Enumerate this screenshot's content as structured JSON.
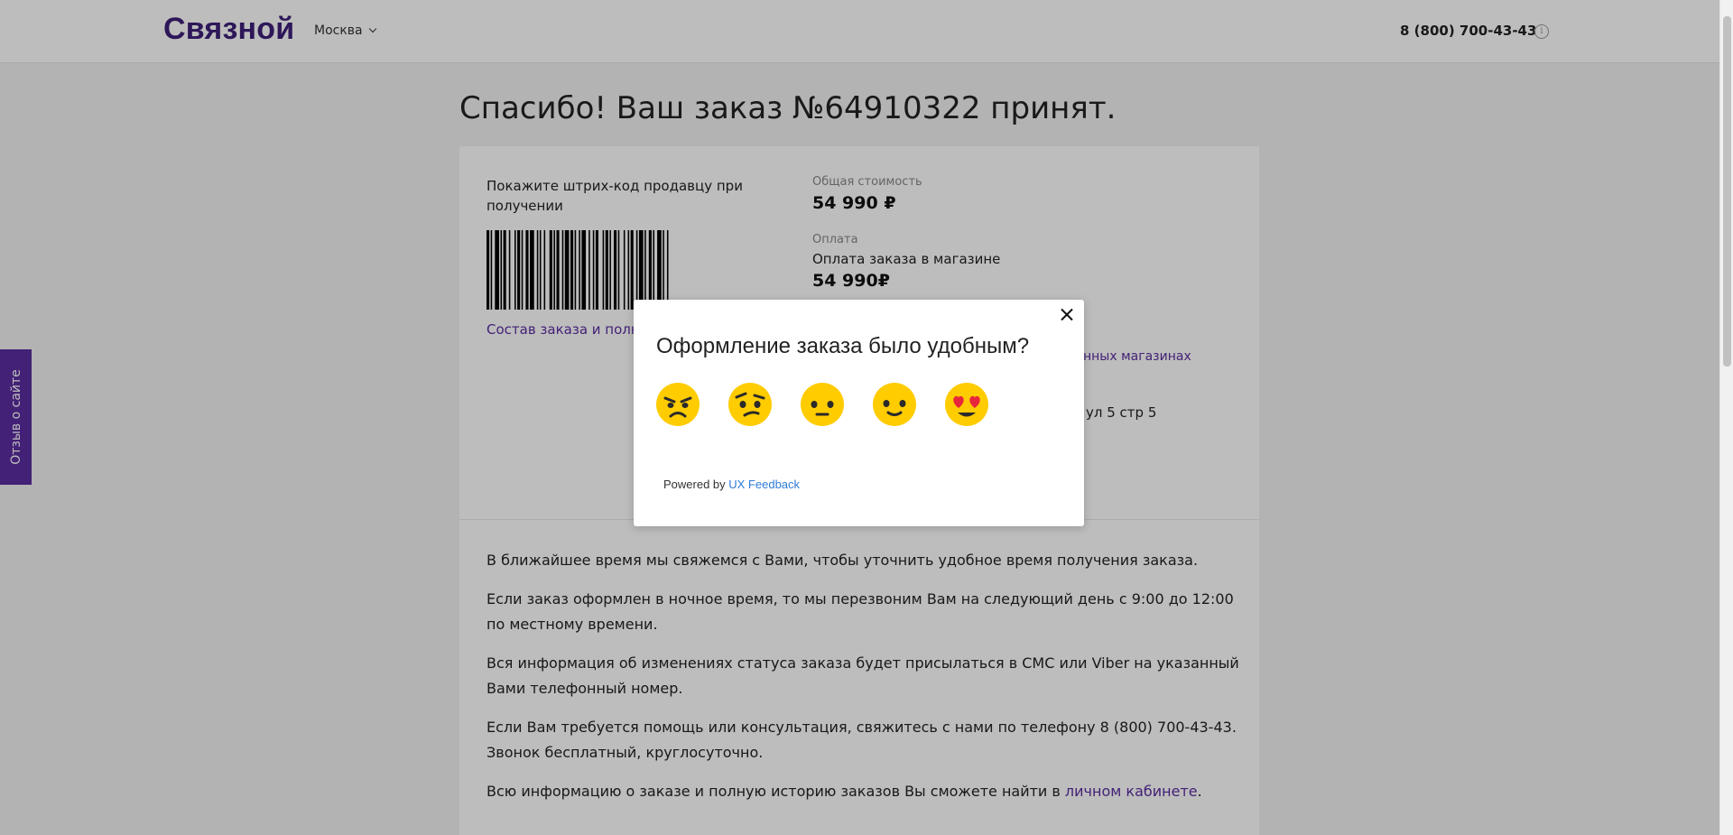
{
  "header": {
    "logo": "Связной",
    "city": "Москва",
    "phone": "8 (800) 700-43-43",
    "info_icon": "info-icon"
  },
  "side_tab": {
    "label": "Отзыв о сайте"
  },
  "page": {
    "title": "Спасибо! Ваш заказ №64910322 принят."
  },
  "order": {
    "barcode_note": "Покажите штрих-код продавцу при получении",
    "order_link": "Состав заказа и полная информация",
    "total_label": "Общая стоимость",
    "total_value": "54 990 ₽",
    "payment_label": "Оплата",
    "payment_method": "Оплата заказа в магазине",
    "payment_value": "54 990₽",
    "stores_link_fragment": "нных магазинах",
    "address_fragment": "ул 5 стр 5"
  },
  "info": {
    "p1": "В ближайшее время мы свяжемся с Вами, чтобы уточнить удобное время получения заказа.",
    "p2": "Если заказ оформлен в ночное время, то мы перезвоним Вам на следующий день с 9:00 до 12:00 по местному времени.",
    "p3": "Вся информация об изменениях статуса заказа будет присылаться в СМС или Viber на указанный Вами телефонный номер.",
    "p4": "Если Вам требуется помощь или консультация, свяжитесь с нами по телефону 8 (800) 700-43-43. Звонок бесплатный, круглосуточно.",
    "p5_prefix": "Всю информацию о заказе и полную историю заказов Вы сможете найти в ",
    "p5_link": "личном кабинете",
    "p5_suffix": "."
  },
  "modal": {
    "question": "Оформление заказа было удобным?",
    "emojis": [
      "angry-face-icon",
      "confused-face-icon",
      "neutral-face-icon",
      "slightly-smiling-face-icon",
      "heart-eyes-face-icon"
    ],
    "powered_prefix": "Powered by ",
    "powered_link": "UX Feedback",
    "close_icon": "close-icon"
  },
  "colors": {
    "brand": "#3f1f78",
    "accent": "#5b2da0",
    "emoji": "#ffcc00",
    "link_blue": "#2f7bd8"
  }
}
